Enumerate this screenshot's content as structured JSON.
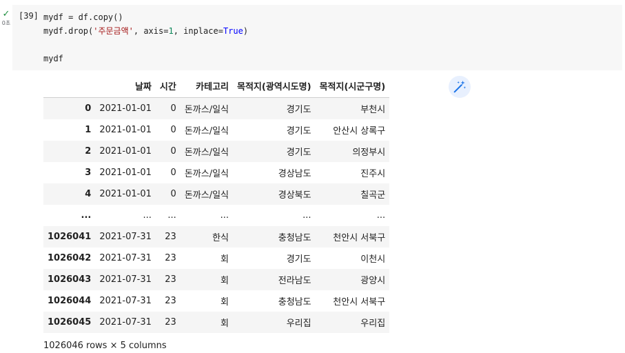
{
  "cell": {
    "exec_count": "[39]",
    "exec_time": "0초",
    "code_lines": [
      [
        {
          "t": "mydf = df.copy()",
          "c": ""
        }
      ],
      [
        {
          "t": "mydf.drop(",
          "c": ""
        },
        {
          "t": "'주문금액'",
          "c": "str"
        },
        {
          "t": ", axis=",
          "c": ""
        },
        {
          "t": "1",
          "c": "num"
        },
        {
          "t": ", inplace=",
          "c": ""
        },
        {
          "t": "True",
          "c": "kw"
        },
        {
          "t": ")",
          "c": ""
        }
      ],
      [
        {
          "t": "",
          "c": ""
        }
      ],
      [
        {
          "t": "mydf",
          "c": ""
        }
      ]
    ]
  },
  "table": {
    "columns": [
      "",
      "날짜",
      "시간",
      "카테고리",
      "목적지(광역시도명)",
      "목적지(시군구명)"
    ],
    "rows": [
      [
        "0",
        "2021-01-01",
        "0",
        "돈까스/일식",
        "경기도",
        "부천시"
      ],
      [
        "1",
        "2021-01-01",
        "0",
        "돈까스/일식",
        "경기도",
        "안산시 상록구"
      ],
      [
        "2",
        "2021-01-01",
        "0",
        "돈까스/일식",
        "경기도",
        "의정부시"
      ],
      [
        "3",
        "2021-01-01",
        "0",
        "돈까스/일식",
        "경상남도",
        "진주시"
      ],
      [
        "4",
        "2021-01-01",
        "0",
        "돈까스/일식",
        "경상북도",
        "칠곡군"
      ],
      [
        "...",
        "...",
        "...",
        "...",
        "...",
        "..."
      ],
      [
        "1026041",
        "2021-07-31",
        "23",
        "한식",
        "충청남도",
        "천안시 서북구"
      ],
      [
        "1026042",
        "2021-07-31",
        "23",
        "회",
        "경기도",
        "이천시"
      ],
      [
        "1026043",
        "2021-07-31",
        "23",
        "회",
        "전라남도",
        "광양시"
      ],
      [
        "1026044",
        "2021-07-31",
        "23",
        "회",
        "충청남도",
        "천안시 서북구"
      ],
      [
        "1026045",
        "2021-07-31",
        "23",
        "회",
        "우리집",
        "우리집"
      ]
    ]
  },
  "shape_text": "1026046 rows × 5 columns",
  "icons": {
    "status": "check-icon",
    "magic": "magic-wand-sparkle-icon"
  },
  "colors": {
    "check": "#1e8e3e",
    "magic_icon": "#1a73e8",
    "magic_bg": "#e8f0fe",
    "string": "#a31515",
    "number": "#098658",
    "keyword": "#0000ff"
  }
}
